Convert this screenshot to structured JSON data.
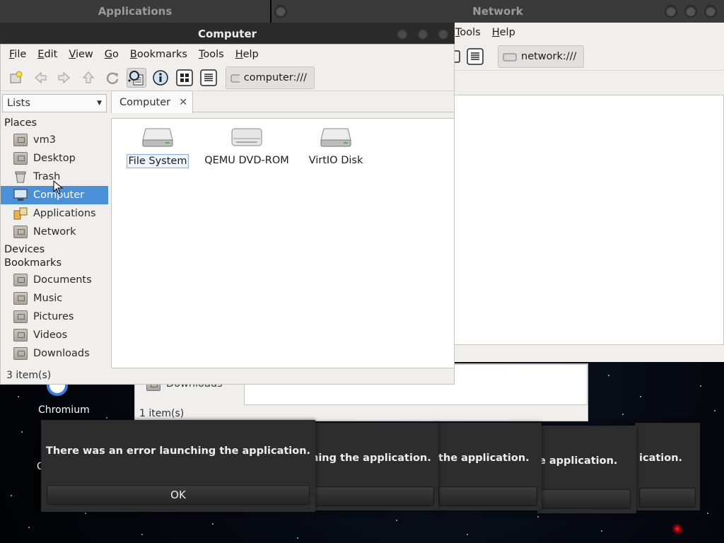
{
  "desktop": {
    "chromium_label": "Chromium"
  },
  "apps_window": {
    "title": "Applications",
    "sidebar_item": "Downloads",
    "status": "1 item(s)"
  },
  "network_window": {
    "title": "Network",
    "menu": [
      "Tools",
      "Help"
    ],
    "location": "network:///"
  },
  "computer_window": {
    "title": "Computer",
    "menu": [
      "File",
      "Edit",
      "View",
      "Go",
      "Bookmarks",
      "Tools",
      "Help"
    ],
    "location": "computer:///",
    "sidebar_selector": "Lists",
    "sections": {
      "places": "Places",
      "devices": "Devices",
      "bookmarks": "Bookmarks"
    },
    "places": [
      "vm3",
      "Desktop",
      "Trash",
      "Computer",
      "Applications",
      "Network"
    ],
    "bookmarks": [
      "Documents",
      "Music",
      "Pictures",
      "Videos",
      "Downloads"
    ],
    "tab_label": "Computer",
    "drives": [
      "File System",
      "QEMU DVD-ROM",
      "VirtIO Disk"
    ],
    "status": "3 item(s)"
  },
  "dialogs": {
    "message": "There was an error launching the application.",
    "fragments": [
      "ning the application.",
      "the application.",
      "e application.",
      "ication."
    ],
    "ok_label": "OK"
  },
  "colors": {
    "selection": "#4a90d9",
    "titlebar": "#2b2b2b",
    "dialog": "#2d2d2d"
  }
}
